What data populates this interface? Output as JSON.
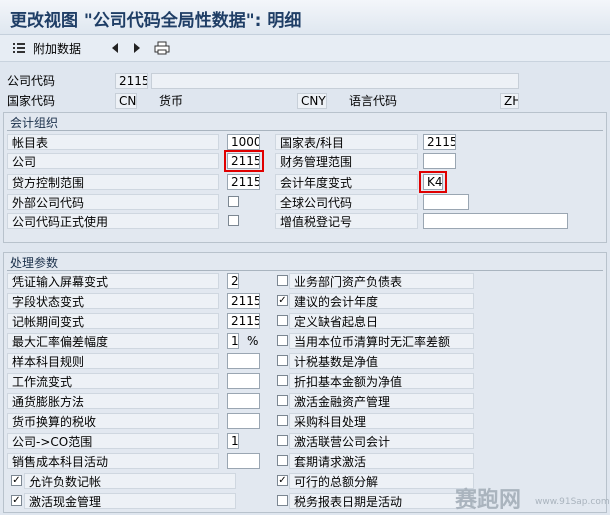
{
  "title": "更改视图 \"公司代码全局性数据\": 明细",
  "toolbar": {
    "additional_data": "附加数据"
  },
  "header": {
    "company_code_label": "公司代码",
    "company_code": "2115",
    "country_label": "国家代码",
    "country": "CN",
    "currency_label": "货币",
    "currency": "CNY",
    "language_label": "语言代码",
    "language": "ZH"
  },
  "org": {
    "title": "会计组织",
    "chart_of_accounts_label": "帐目表",
    "chart_of_accounts": "1000",
    "company_label": "公司",
    "company": "2115",
    "credit_control_label": "贷方控制范围",
    "credit_control": "2115",
    "external_cc_label": "外部公司代码",
    "cc_productive_label": "公司代码正式使用",
    "country_chart_label": "国家表/科目",
    "country_chart": "2115",
    "fm_area_label": "财务管理范围",
    "fm_area": "",
    "fiscal_year_variant_label": "会计年度变式",
    "fiscal_year_variant": "K4",
    "global_cc_label": "全球公司代码",
    "global_cc": "",
    "vat_reg_label": "增值税登记号",
    "vat_reg": ""
  },
  "proc": {
    "title": "处理参数",
    "left": [
      {
        "label": "凭证输入屏幕变式",
        "value": "2",
        "type": "field"
      },
      {
        "label": "字段状态变式",
        "value": "2115",
        "type": "field"
      },
      {
        "label": "记帐期间变式",
        "value": "2115",
        "type": "field"
      },
      {
        "label": "最大汇率偏差幅度",
        "value": "10",
        "unit": "%",
        "type": "field"
      },
      {
        "label": "样本科目规则",
        "value": "",
        "type": "field"
      },
      {
        "label": "工作流变式",
        "value": "",
        "type": "field"
      },
      {
        "label": "通货膨胀方法",
        "value": "",
        "type": "field"
      },
      {
        "label": "货币换算的税收",
        "value": "",
        "type": "field"
      },
      {
        "label": "公司->CO范围",
        "value": "1",
        "type": "field"
      },
      {
        "label": "销售成本科目活动",
        "value": "",
        "type": "field"
      },
      {
        "label": "允许负数记帐",
        "checked": true,
        "type": "check"
      },
      {
        "label": "激活现金管理",
        "checked": true,
        "type": "check"
      }
    ],
    "right": [
      {
        "label": "业务部门资产负债表",
        "checked": false
      },
      {
        "label": "建议的会计年度",
        "checked": true
      },
      {
        "label": "定义缺省起息日",
        "checked": false
      },
      {
        "label": "当用本位币清算时无汇率差额",
        "checked": false
      },
      {
        "label": "计税基数是净值",
        "checked": false
      },
      {
        "label": "折扣基本金额为净值",
        "checked": false
      },
      {
        "label": "激活金融资产管理",
        "checked": false
      },
      {
        "label": "采购科目处理",
        "checked": false
      },
      {
        "label": "激活联营公司会计",
        "checked": false
      },
      {
        "label": "套期请求激活",
        "checked": false
      },
      {
        "label": "可行的总额分解",
        "checked": true
      },
      {
        "label": "税务报表日期是活动",
        "checked": false
      }
    ]
  },
  "watermark": {
    "text": "赛跑网",
    "url": "www.91Sap.com"
  }
}
